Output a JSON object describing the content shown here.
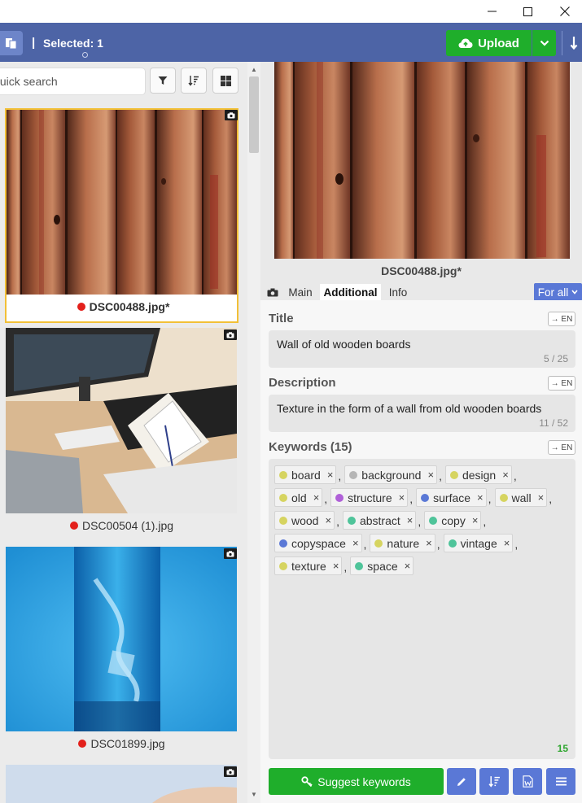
{
  "window": {
    "minimize": "—",
    "maximize": "☐",
    "close": "✕"
  },
  "toolbar": {
    "separator": "|",
    "selected_label": "Selected: 1",
    "upload_label": "Upload"
  },
  "left": {
    "search_placeholder": "Quick search",
    "images": [
      {
        "filename": "DSC00488.jpg*",
        "selected": true,
        "status_color": "#e3201b"
      },
      {
        "filename": "DSC00504 (1).jpg",
        "selected": false,
        "status_color": "#e3201b"
      },
      {
        "filename": "DSC01899.jpg",
        "selected": false,
        "status_color": "#e3201b"
      }
    ]
  },
  "preview": {
    "filename": "DSC00488.jpg*"
  },
  "tabs": {
    "items": [
      "Main",
      "Additional",
      "Info"
    ],
    "active": "Additional",
    "scope_label": "For all"
  },
  "form": {
    "translate_label": "→ EN",
    "title": {
      "label": "Title",
      "value": "Wall of old wooden boards",
      "count": "5 / 25"
    },
    "description": {
      "label": "Description",
      "value": "Texture in the form of a wall from old wooden boards",
      "count": "11 / 52"
    },
    "keywords": {
      "label": "Keywords",
      "count_label": "(15)",
      "total": "15",
      "items": [
        {
          "text": "board",
          "color": "#d6d460"
        },
        {
          "text": "background",
          "color": "#b5b5b5"
        },
        {
          "text": "design",
          "color": "#d6d460"
        },
        {
          "text": "old",
          "color": "#d6d460"
        },
        {
          "text": "structure",
          "color": "#b060d8"
        },
        {
          "text": "surface",
          "color": "#5a78d6"
        },
        {
          "text": "wall",
          "color": "#d6d460"
        },
        {
          "text": "wood",
          "color": "#d6d460"
        },
        {
          "text": "abstract",
          "color": "#4fc49a"
        },
        {
          "text": "copy",
          "color": "#4fc49a"
        },
        {
          "text": "copyspace",
          "color": "#5a78d6"
        },
        {
          "text": "nature",
          "color": "#d6d460"
        },
        {
          "text": "vintage",
          "color": "#4fc49a"
        },
        {
          "text": "texture",
          "color": "#d6d460"
        },
        {
          "text": "space",
          "color": "#4fc49a"
        }
      ]
    },
    "suggest_label": "Suggest keywords"
  },
  "colors": {
    "accent_blue": "#4d64a6",
    "button_blue": "#5a78d6",
    "green": "#1fae2b",
    "selection": "#f2c037"
  }
}
